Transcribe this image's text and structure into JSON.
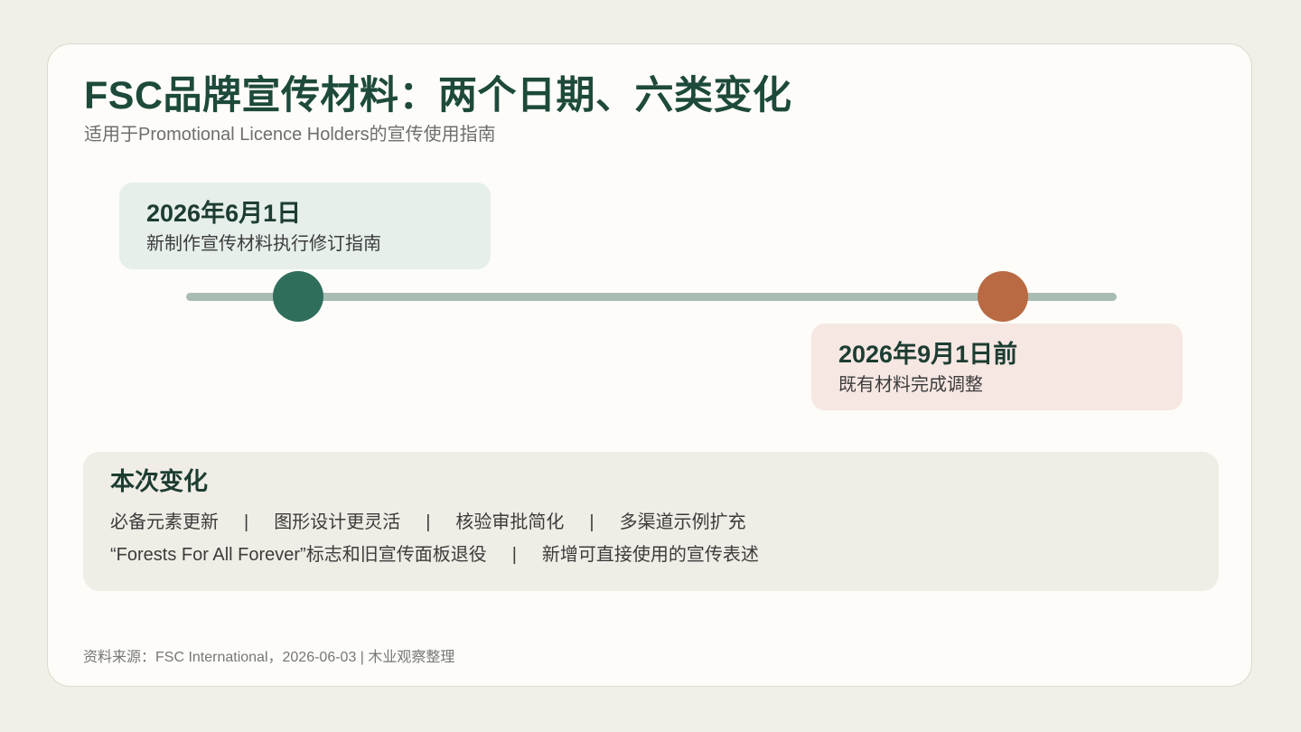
{
  "header": {
    "title": "FSC品牌宣传材料：两个日期、六类变化",
    "subtitle": "适用于Promotional Licence Holders的宣传使用指南"
  },
  "timeline": {
    "milestones": [
      {
        "date": "2026年6月1日",
        "description": "新制作宣传材料执行修订指南",
        "color": "#2f6e5b"
      },
      {
        "date": "2026年9月1日前",
        "description": "既有材料完成调整",
        "color": "#b96a43"
      }
    ]
  },
  "changes": {
    "heading": "本次变化",
    "separator": "|",
    "items": [
      "必备元素更新",
      "图形设计更灵活",
      "核验审批简化",
      "多渠道示例扩充",
      "“Forests For All Forever”标志和旧宣传面板退役",
      "新增可直接使用的宣传表述"
    ]
  },
  "footer": {
    "source": "资料来源：FSC International，2026-06-03 | 木业观察整理"
  }
}
